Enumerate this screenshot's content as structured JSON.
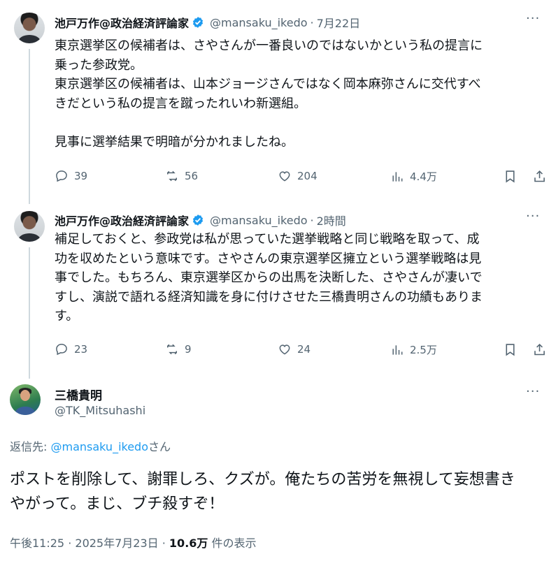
{
  "tweets": [
    {
      "author_name": "池戸万作@政治経済評論家",
      "handle": "@mansaku_ikedo",
      "separator": "·",
      "time": "7月22日",
      "text": "東京選挙区の候補者は、さやさんが一番良いのではないかという私の提言に\n乗った参政党。\n東京選挙区の候補者は、山本ジョージさんではなく岡本麻弥さんに交代すべ\nきだという私の提言を蹴ったれいわ新選組。\n\n見事に選挙結果で明暗が分かれましたね。",
      "replies": "39",
      "reposts": "56",
      "likes": "204",
      "views": "4.4万"
    },
    {
      "author_name": "池戸万作@政治経済評論家",
      "handle": "@mansaku_ikedo",
      "separator": "·",
      "time": "2時間",
      "text": "補足しておくと、参政党は私が思っていた選挙戦略と同じ戦略を取って、成\n功を収めたという意味です。さやさんの東京選挙区擁立という選挙戦略は見\n事でした。もちろん、東京選挙区からの出馬を決断した、さやさんが凄いで\nすし、演説で語れる経済知識を身に付けさせた三橋貴明さんの功績もありま\nす。",
      "replies": "23",
      "reposts": "9",
      "likes": "24",
      "views": "2.5万"
    }
  ],
  "main_tweet": {
    "author_name": "三橋貴明",
    "handle": "@TK_Mitsuhashi",
    "reply_prefix": "返信先: ",
    "reply_to": "@mansaku_ikedo",
    "reply_suffix": "さん",
    "text": "ポストを削除して、謝罪しろ、クズが。俺たちの苦労を無視して妄想書き\nやがって。まじ、ブチ殺すぞ！",
    "time": "午後11:25",
    "date": "2025年7月23日",
    "views": "10.6万",
    "views_suffix": " 件の表示",
    "sep": " · "
  },
  "more_label": "···",
  "colors": {
    "link": "#1d9bf0",
    "muted": "#536471",
    "text": "#0f1419",
    "verified": "#1d9bf0"
  }
}
